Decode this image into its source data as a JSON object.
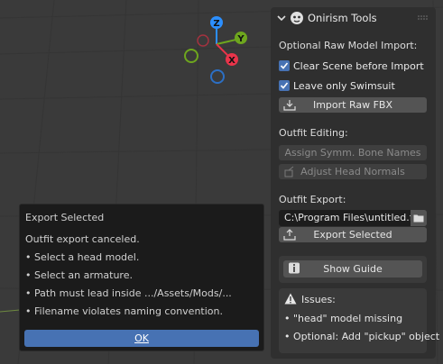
{
  "gizmo": {
    "z_label": "Z",
    "y_label": "Y",
    "x_label": "X",
    "colors": {
      "x": "#e8344a",
      "y": "#6ea61e",
      "z": "#2c8fff"
    }
  },
  "panel": {
    "title": "Onirism Tools",
    "sections": {
      "raw_import_label": "Optional Raw Model Import:",
      "clear_scene_label": "Clear Scene before Import",
      "leave_swimsuit_label": "Leave only Swimsuit",
      "import_button": "Import Raw FBX",
      "outfit_editing_label": "Outfit Editing:",
      "assign_bones_button": "Assign Symm. Bone Names",
      "adjust_normals_button": "Adjust Head Normals",
      "outfit_export_label": "Outfit Export:",
      "export_path_value": "C:\\Program Files\\untitled.f...",
      "export_button": "Export Selected",
      "guide_button": "Show Guide"
    },
    "issues": {
      "title": "Issues:",
      "items": [
        "• \"head\" model missing",
        "• Optional: Add \"pickup\" object"
      ]
    },
    "accent": "#4772b3"
  },
  "dialog": {
    "title": "Export Selected",
    "lines": [
      "Outfit export canceled.",
      "• Select a head model.",
      "• Select an armature.",
      "• Path must lead inside .../Assets/Mods/...",
      "• Filename violates naming convention."
    ],
    "ok_label": "OK"
  }
}
